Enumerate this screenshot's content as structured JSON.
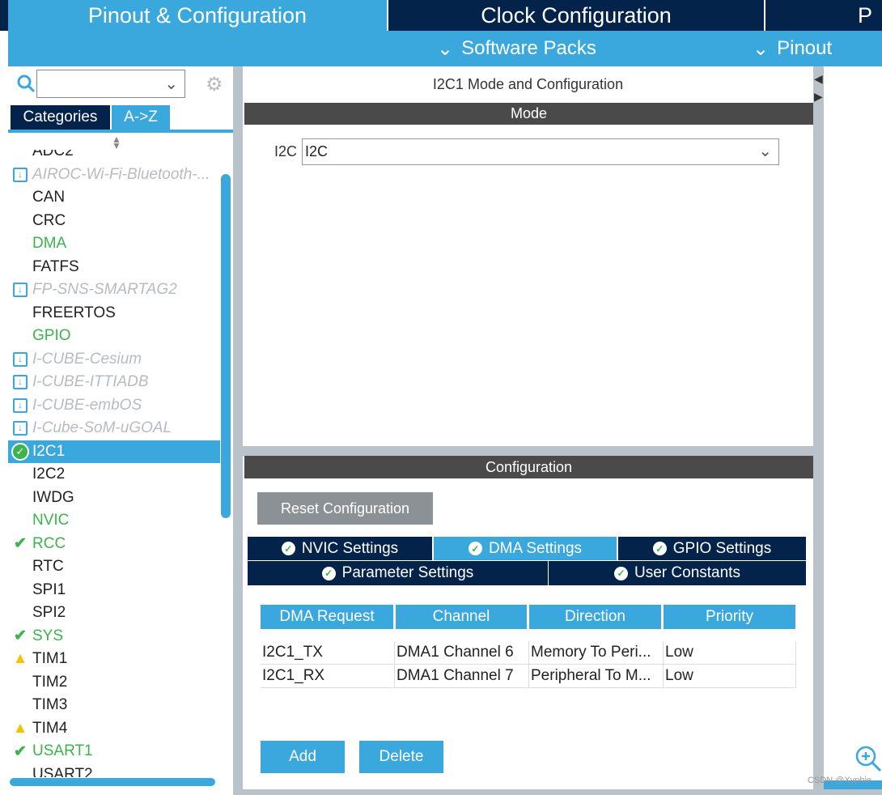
{
  "top_tabs": [
    {
      "label": "Pinout & Configuration",
      "active": true
    },
    {
      "label": "Clock Configuration"
    },
    {
      "label": "P"
    }
  ],
  "sub_menu": {
    "software_packs": "Software Packs",
    "pinout": "Pinout"
  },
  "sidebar": {
    "search_value": "",
    "tabs": [
      "Categories",
      "A->Z"
    ],
    "active_tab": "A->Z",
    "items": [
      {
        "label": "ADC2",
        "state": "normal"
      },
      {
        "label": "AIROC-Wi-Fi-Bluetooth-...",
        "state": "pack"
      },
      {
        "label": "CAN",
        "state": "normal"
      },
      {
        "label": "CRC",
        "state": "normal"
      },
      {
        "label": "DMA",
        "state": "green"
      },
      {
        "label": "FATFS",
        "state": "normal"
      },
      {
        "label": "FP-SNS-SMARTAG2",
        "state": "pack"
      },
      {
        "label": "FREERTOS",
        "state": "normal"
      },
      {
        "label": "GPIO",
        "state": "green"
      },
      {
        "label": "I-CUBE-Cesium",
        "state": "pack"
      },
      {
        "label": "I-CUBE-ITTIADB",
        "state": "pack"
      },
      {
        "label": "I-CUBE-embOS",
        "state": "pack"
      },
      {
        "label": "I-Cube-SoM-uGOAL",
        "state": "pack"
      },
      {
        "label": "I2C1",
        "state": "selected"
      },
      {
        "label": "I2C2",
        "state": "normal"
      },
      {
        "label": "IWDG",
        "state": "normal"
      },
      {
        "label": "NVIC",
        "state": "green"
      },
      {
        "label": "RCC",
        "state": "check"
      },
      {
        "label": "RTC",
        "state": "normal"
      },
      {
        "label": "SPI1",
        "state": "normal"
      },
      {
        "label": "SPI2",
        "state": "normal"
      },
      {
        "label": "SYS",
        "state": "check"
      },
      {
        "label": "TIM1",
        "state": "warning"
      },
      {
        "label": "TIM2",
        "state": "normal"
      },
      {
        "label": "TIM3",
        "state": "normal"
      },
      {
        "label": "TIM4",
        "state": "warning"
      },
      {
        "label": "USART1",
        "state": "check"
      },
      {
        "label": "USART2",
        "state": "normal"
      }
    ]
  },
  "main": {
    "title": "I2C1 Mode and Configuration",
    "mode_header": "Mode",
    "mode_label": "I2C",
    "mode_value": "I2C",
    "config_header": "Configuration",
    "reset_button": "Reset Configuration",
    "tabs_row1": [
      "NVIC Settings",
      "DMA Settings",
      "GPIO Settings"
    ],
    "tabs_row2": [
      "Parameter Settings",
      "User Constants"
    ],
    "active_tab": "DMA Settings",
    "table": {
      "headers": [
        "DMA Request",
        "Channel",
        "Direction",
        "Priority"
      ],
      "rows": [
        [
          "I2C1_TX",
          "DMA1 Channel 6",
          "Memory To Peri...",
          "Low"
        ],
        [
          "I2C1_RX",
          "DMA1 Channel 7",
          "Peripheral To M...",
          "Low"
        ]
      ]
    },
    "add_button": "Add",
    "delete_button": "Delete"
  },
  "watermark": "CSDN @Xyphie",
  "colors": {
    "navy": "#03234b",
    "accent": "#3aa8dc",
    "green": "#3cb44b",
    "warning": "#f5c400"
  }
}
